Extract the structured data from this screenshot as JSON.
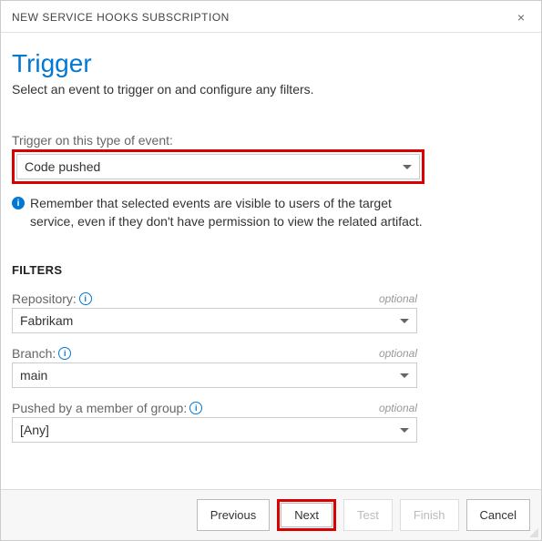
{
  "header": {
    "title": "NEW SERVICE HOOKS SUBSCRIPTION",
    "close": "×"
  },
  "page": {
    "title": "Trigger",
    "subtitle": "Select an event to trigger on and configure any filters."
  },
  "event": {
    "label": "Trigger on this type of event:",
    "value": "Code pushed"
  },
  "info": {
    "text": "Remember that selected events are visible to users of the target service, even if they don't have permission to view the related artifact."
  },
  "filters": {
    "heading": "FILTERS",
    "optional": "optional",
    "repository": {
      "label": "Repository:",
      "value": "Fabrikam"
    },
    "branch": {
      "label": "Branch:",
      "value": "main"
    },
    "group": {
      "label": "Pushed by a member of group:",
      "value": "[Any]"
    }
  },
  "buttons": {
    "previous": "Previous",
    "next": "Next",
    "test": "Test",
    "finish": "Finish",
    "cancel": "Cancel"
  }
}
